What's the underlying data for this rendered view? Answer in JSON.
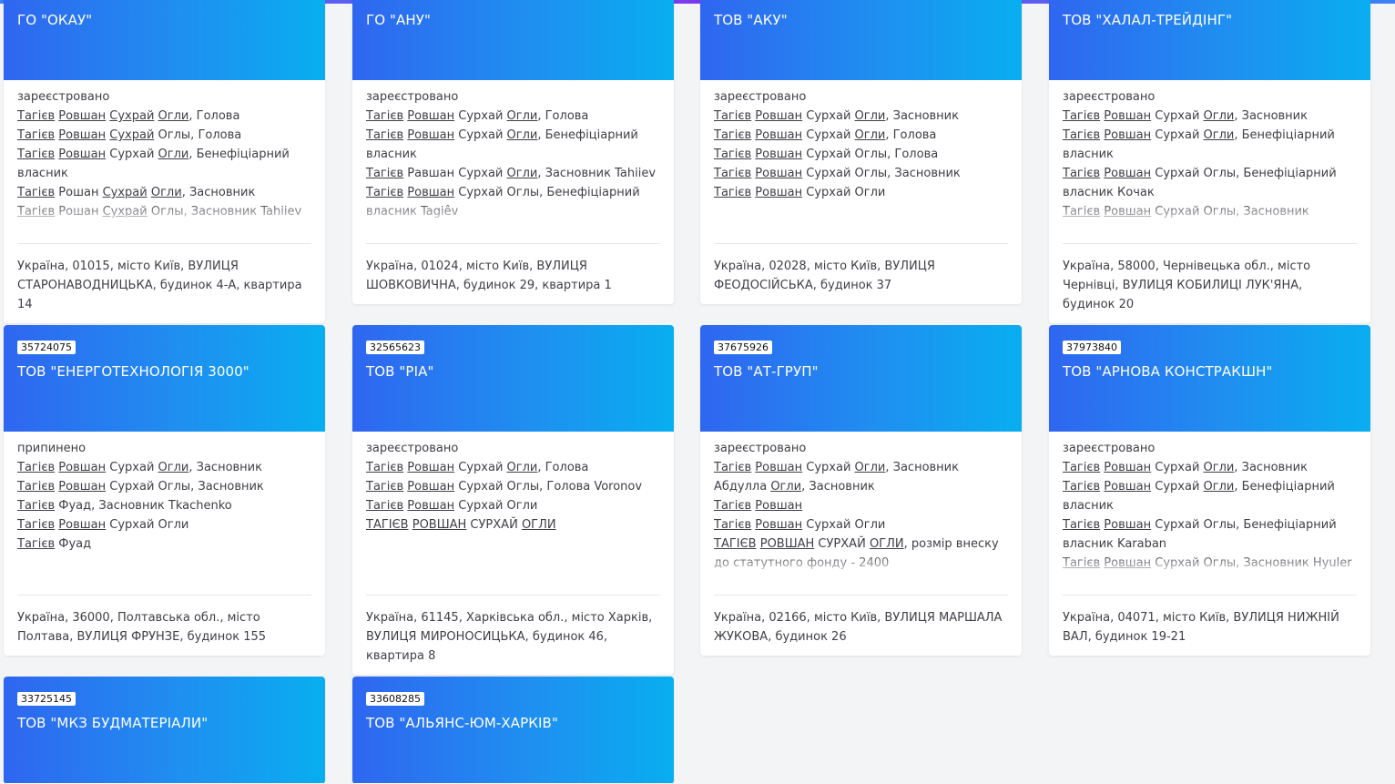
{
  "cards": [
    {
      "id": "",
      "name": "ГО \"ОКАУ\"",
      "status": "зареєстровано",
      "lines": [
        [
          {
            "t": "Тагієв",
            "u": true
          },
          {
            "t": " "
          },
          {
            "t": "Ровшан",
            "u": true
          },
          {
            "t": " "
          },
          {
            "t": "Сухрай",
            "u": true
          },
          {
            "t": " "
          },
          {
            "t": "Огли",
            "u": true
          },
          {
            "t": ", Голова"
          }
        ],
        [
          {
            "t": "Тагієв",
            "u": true
          },
          {
            "t": " "
          },
          {
            "t": "Ровшан",
            "u": true
          },
          {
            "t": " "
          },
          {
            "t": "Сухрай",
            "u": true
          },
          {
            "t": " Оглы, Голова"
          }
        ],
        [
          {
            "t": "Тагієв",
            "u": true
          },
          {
            "t": " "
          },
          {
            "t": "Ровшан",
            "u": true
          },
          {
            "t": " Сурхай "
          },
          {
            "t": "Огли",
            "u": true
          },
          {
            "t": ", Бенефіціарний власник"
          }
        ],
        [
          {
            "t": "Тагієв",
            "u": true
          },
          {
            "t": " Рошан "
          },
          {
            "t": "Сухрай",
            "u": true
          },
          {
            "t": " "
          },
          {
            "t": "Огли",
            "u": true
          },
          {
            "t": ", Засновник"
          }
        ],
        [
          {
            "t": "Тагієв",
            "u": true
          },
          {
            "t": " Рошан "
          },
          {
            "t": "Сухрай",
            "u": true
          },
          {
            "t": " Оглы, Засновник Tahiiev"
          }
        ]
      ],
      "address": "Україна, 01015, місто Київ, ВУЛИЦЯ СТАРОНАВОДНИЦЬКА, будинок 4-А, квартира 14"
    },
    {
      "id": "",
      "name": "ГО \"АНУ\"",
      "status": "зареєстровано",
      "lines": [
        [
          {
            "t": "Тагієв",
            "u": true
          },
          {
            "t": " "
          },
          {
            "t": "Ровшан",
            "u": true
          },
          {
            "t": " Сурхай "
          },
          {
            "t": "Огли",
            "u": true
          },
          {
            "t": ", Голова"
          }
        ],
        [
          {
            "t": "Тагієв",
            "u": true
          },
          {
            "t": " "
          },
          {
            "t": "Ровшан",
            "u": true
          },
          {
            "t": " Сурхай "
          },
          {
            "t": "Огли",
            "u": true
          },
          {
            "t": ", Бенефіціарний власник"
          }
        ],
        [
          {
            "t": "Тагієв",
            "u": true
          },
          {
            "t": " Равшан Сурхай "
          },
          {
            "t": "Огли",
            "u": true
          },
          {
            "t": ", Засновник Tahiiev"
          }
        ],
        [
          {
            "t": "Тагієв",
            "u": true
          },
          {
            "t": " "
          },
          {
            "t": "Ровшан",
            "u": true
          },
          {
            "t": " Сурхай Оглы, Бенефіціарний власник Tagiêv"
          }
        ]
      ],
      "address": "Україна, 01024, місто Київ, ВУЛИЦЯ ШОВКОВИЧНА, будинок 29, квартира 1"
    },
    {
      "id": "",
      "name": "ТОВ \"АКУ\"",
      "status": "зареєстровано",
      "lines": [
        [
          {
            "t": "Тагієв",
            "u": true
          },
          {
            "t": " "
          },
          {
            "t": "Ровшан",
            "u": true
          },
          {
            "t": " Сурхай "
          },
          {
            "t": "Огли",
            "u": true
          },
          {
            "t": ", Засновник"
          }
        ],
        [
          {
            "t": "Тагієв",
            "u": true
          },
          {
            "t": " "
          },
          {
            "t": "Ровшан",
            "u": true
          },
          {
            "t": " Сурхай "
          },
          {
            "t": "Огли",
            "u": true
          },
          {
            "t": ", Голова"
          }
        ],
        [
          {
            "t": "Тагієв",
            "u": true
          },
          {
            "t": " "
          },
          {
            "t": "Ровшан",
            "u": true
          },
          {
            "t": " Сурхай Оглы, Голова"
          }
        ],
        [
          {
            "t": "Тагієв",
            "u": true
          },
          {
            "t": " "
          },
          {
            "t": "Ровшан",
            "u": true
          },
          {
            "t": " Сурхай Оглы, Засновник"
          }
        ],
        [
          {
            "t": "Тагієв",
            "u": true
          },
          {
            "t": " "
          },
          {
            "t": "Ровшан",
            "u": true
          },
          {
            "t": " Сурхай Огли"
          }
        ]
      ],
      "address": "Україна, 02028, місто Київ, ВУЛИЦЯ ФЕОДОСІЙСЬКА, будинок 37"
    },
    {
      "id": "",
      "name": "ТОВ \"ХАЛАЛ-ТРЕЙДІНГ\"",
      "status": "зареєстровано",
      "lines": [
        [
          {
            "t": "Тагієв",
            "u": true
          },
          {
            "t": " "
          },
          {
            "t": "Ровшан",
            "u": true
          },
          {
            "t": " Сурхай "
          },
          {
            "t": "Огли",
            "u": true
          },
          {
            "t": ", Засновник"
          }
        ],
        [
          {
            "t": "Тагієв",
            "u": true
          },
          {
            "t": " "
          },
          {
            "t": "Ровшан",
            "u": true
          },
          {
            "t": " Сурхай "
          },
          {
            "t": "Огли",
            "u": true
          },
          {
            "t": ", Бенефіціарний власник"
          }
        ],
        [
          {
            "t": "Тагієв",
            "u": true
          },
          {
            "t": " "
          },
          {
            "t": "Ровшан",
            "u": true
          },
          {
            "t": " Сурхай Оглы, Бенефіціарний власник Кочак"
          }
        ],
        [
          {
            "t": "Тагієв",
            "u": true
          },
          {
            "t": " "
          },
          {
            "t": "Ровшан",
            "u": true
          },
          {
            "t": " Сурхай Оглы, Засновник"
          }
        ]
      ],
      "address": "Україна, 58000, Чернівецька обл., місто Чернівці, ВУЛИЦЯ КОБИЛИЦІ ЛУК'ЯНА, будинок 20"
    },
    {
      "id": "35724075",
      "name": "ТОВ \"ЕНЕРГОТЕХНОЛОГІЯ 3000\"",
      "status": "припинено",
      "lines": [
        [
          {
            "t": "Тагієв",
            "u": true
          },
          {
            "t": " "
          },
          {
            "t": "Ровшан",
            "u": true
          },
          {
            "t": " Сурхай "
          },
          {
            "t": "Огли",
            "u": true
          },
          {
            "t": ", Засновник"
          }
        ],
        [
          {
            "t": "Тагієв",
            "u": true
          },
          {
            "t": " "
          },
          {
            "t": "Ровшан",
            "u": true
          },
          {
            "t": " Сурхай Оглы, Засновник"
          }
        ],
        [
          {
            "t": "Тагієв",
            "u": true
          },
          {
            "t": " Фуад, Засновник Tkachenko"
          }
        ],
        [
          {
            "t": "Тагієв",
            "u": true
          },
          {
            "t": " "
          },
          {
            "t": "Ровшан",
            "u": true
          },
          {
            "t": " Сурхай Огли"
          }
        ],
        [
          {
            "t": "Тагієв",
            "u": true
          },
          {
            "t": " Фуад"
          }
        ]
      ],
      "address": "Україна, 36000, Полтавська обл., місто Полтава, ВУЛИЦЯ ФРУНЗЕ, будинок 155"
    },
    {
      "id": "32565623",
      "name": "ТОВ \"РІА\"",
      "status": "зареєстровано",
      "lines": [
        [
          {
            "t": "Тагієв",
            "u": true
          },
          {
            "t": " "
          },
          {
            "t": "Ровшан",
            "u": true
          },
          {
            "t": " Сурхай "
          },
          {
            "t": "Огли",
            "u": true
          },
          {
            "t": ", Голова"
          }
        ],
        [
          {
            "t": "Тагієв",
            "u": true
          },
          {
            "t": " "
          },
          {
            "t": "Ровшан",
            "u": true
          },
          {
            "t": " Сурхай Оглы, Голова Voronov"
          }
        ],
        [
          {
            "t": "Тагієв",
            "u": true
          },
          {
            "t": " "
          },
          {
            "t": "Ровшан",
            "u": true
          },
          {
            "t": " Сурхай Огли"
          }
        ],
        [
          {
            "t": "ТАГІЄВ",
            "u": true
          },
          {
            "t": " "
          },
          {
            "t": "РОВШАН",
            "u": true
          },
          {
            "t": " СУРХАЙ "
          },
          {
            "t": "ОГЛИ",
            "u": true
          }
        ]
      ],
      "address": "Україна, 61145, Харківська обл., місто Харків, ВУЛИЦЯ МИРОНОСИЦЬКА, будинок 46, квартира 8"
    },
    {
      "id": "37675926",
      "name": "ТОВ \"АТ-ГРУП\"",
      "status": "зареєстровано",
      "lines": [
        [
          {
            "t": "Тагієв",
            "u": true
          },
          {
            "t": " "
          },
          {
            "t": "Ровшан",
            "u": true
          },
          {
            "t": " Сурхай "
          },
          {
            "t": "Огли",
            "u": true
          },
          {
            "t": ", Засновник"
          }
        ],
        [
          {
            "t": "Абдулла "
          },
          {
            "t": "Огли",
            "u": true
          },
          {
            "t": ", Засновник"
          }
        ],
        [
          {
            "t": "Тагієв",
            "u": true
          },
          {
            "t": " "
          },
          {
            "t": "Ровшан",
            "u": true
          }
        ],
        [
          {
            "t": "Тагієв",
            "u": true
          },
          {
            "t": " "
          },
          {
            "t": "Ровшан",
            "u": true
          },
          {
            "t": " Сурхай Огли"
          }
        ],
        [
          {
            "t": "ТАГІЄВ",
            "u": true
          },
          {
            "t": " "
          },
          {
            "t": "РОВШАН",
            "u": true
          },
          {
            "t": " СУРХАЙ "
          },
          {
            "t": "ОГЛИ",
            "u": true
          },
          {
            "t": ", розмір внеску до статутного фонду - 2400"
          }
        ]
      ],
      "address": "Україна, 02166, місто Київ, ВУЛИЦЯ МАРШАЛА ЖУКОВА, будинок 26"
    },
    {
      "id": "37973840",
      "name": "ТОВ \"АРНОВА КОНСТРАКШН\"",
      "status": "зареєстровано",
      "lines": [
        [
          {
            "t": "Тагієв",
            "u": true
          },
          {
            "t": " "
          },
          {
            "t": "Ровшан",
            "u": true
          },
          {
            "t": " Сурхай "
          },
          {
            "t": "Огли",
            "u": true
          },
          {
            "t": ", Засновник"
          }
        ],
        [
          {
            "t": "Тагієв",
            "u": true
          },
          {
            "t": " "
          },
          {
            "t": "Ровшан",
            "u": true
          },
          {
            "t": " Сурхай "
          },
          {
            "t": "Огли",
            "u": true
          },
          {
            "t": ", Бенефіціарний власник"
          }
        ],
        [
          {
            "t": "Тагієв",
            "u": true
          },
          {
            "t": " "
          },
          {
            "t": "Ровшан",
            "u": true
          },
          {
            "t": " Сурхай Оглы, Бенефіціарний власник Karaban"
          }
        ],
        [
          {
            "t": "Тагієв",
            "u": true
          },
          {
            "t": " "
          },
          {
            "t": "Ровшан",
            "u": true
          },
          {
            "t": " Сурхай Оглы, Засновник Hyuler"
          }
        ]
      ],
      "address": "Україна, 04071, місто Київ, ВУЛИЦЯ НИЖНІЙ ВАЛ, будинок 19-21"
    },
    {
      "id": "33725145",
      "name": "ТОВ \"МКЗ БУДМАТЕРІАЛИ\"",
      "status": "",
      "lines": [],
      "address": ""
    },
    {
      "id": "33608285",
      "name": "ТОВ \"АЛЬЯНС-ЮМ-ХАРКІВ\"",
      "status": "",
      "lines": [],
      "address": ""
    }
  ]
}
